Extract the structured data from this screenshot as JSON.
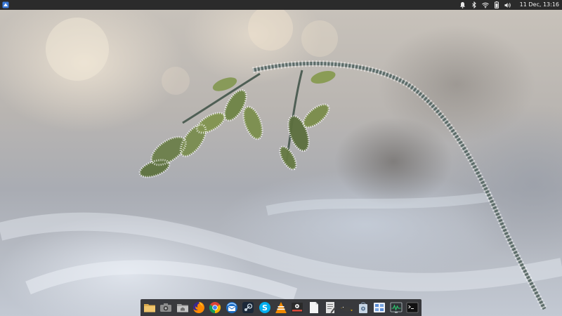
{
  "top_panel": {
    "menu_icon": "app-menu-icon",
    "tray": [
      {
        "name": "notifications-icon"
      },
      {
        "name": "bluetooth-icon"
      },
      {
        "name": "wifi-icon"
      },
      {
        "name": "battery-icon"
      },
      {
        "name": "volume-icon"
      }
    ],
    "clock": "11 Dec, 13:16"
  },
  "desktop": {
    "wallpaper": "frost-covered-branch"
  },
  "dock": {
    "items": [
      {
        "name": "file-manager-icon",
        "color": "#e8c06a"
      },
      {
        "name": "screenshot-icon",
        "color": "#9a9a9a"
      },
      {
        "name": "home-folder-icon",
        "color": "#b5b5b5"
      },
      {
        "name": "firefox-icon",
        "color": "#e66000"
      },
      {
        "name": "chrome-icon",
        "color": "#dd4b39"
      },
      {
        "name": "thunderbird-icon",
        "color": "#1f6fc5"
      },
      {
        "name": "steam-icon",
        "color": "#1b2838"
      },
      {
        "name": "skype-icon",
        "color": "#00aff0"
      },
      {
        "name": "vlc-icon",
        "color": "#f39c12"
      },
      {
        "name": "video-editor-icon",
        "color": "#e8e8e8"
      },
      {
        "name": "document-viewer-icon",
        "color": "#f2f2f2"
      },
      {
        "name": "text-editor-icon",
        "color": "#d9d9d9"
      },
      {
        "name": "tux-icon",
        "color": "#333333"
      },
      {
        "name": "package-manager-icon",
        "color": "#c8d6e5"
      },
      {
        "name": "settings-manager-icon",
        "color": "#5b8dd6"
      },
      {
        "name": "system-monitor-icon",
        "color": "#2ecc71"
      },
      {
        "name": "terminal-icon",
        "color": "#111111"
      }
    ]
  }
}
